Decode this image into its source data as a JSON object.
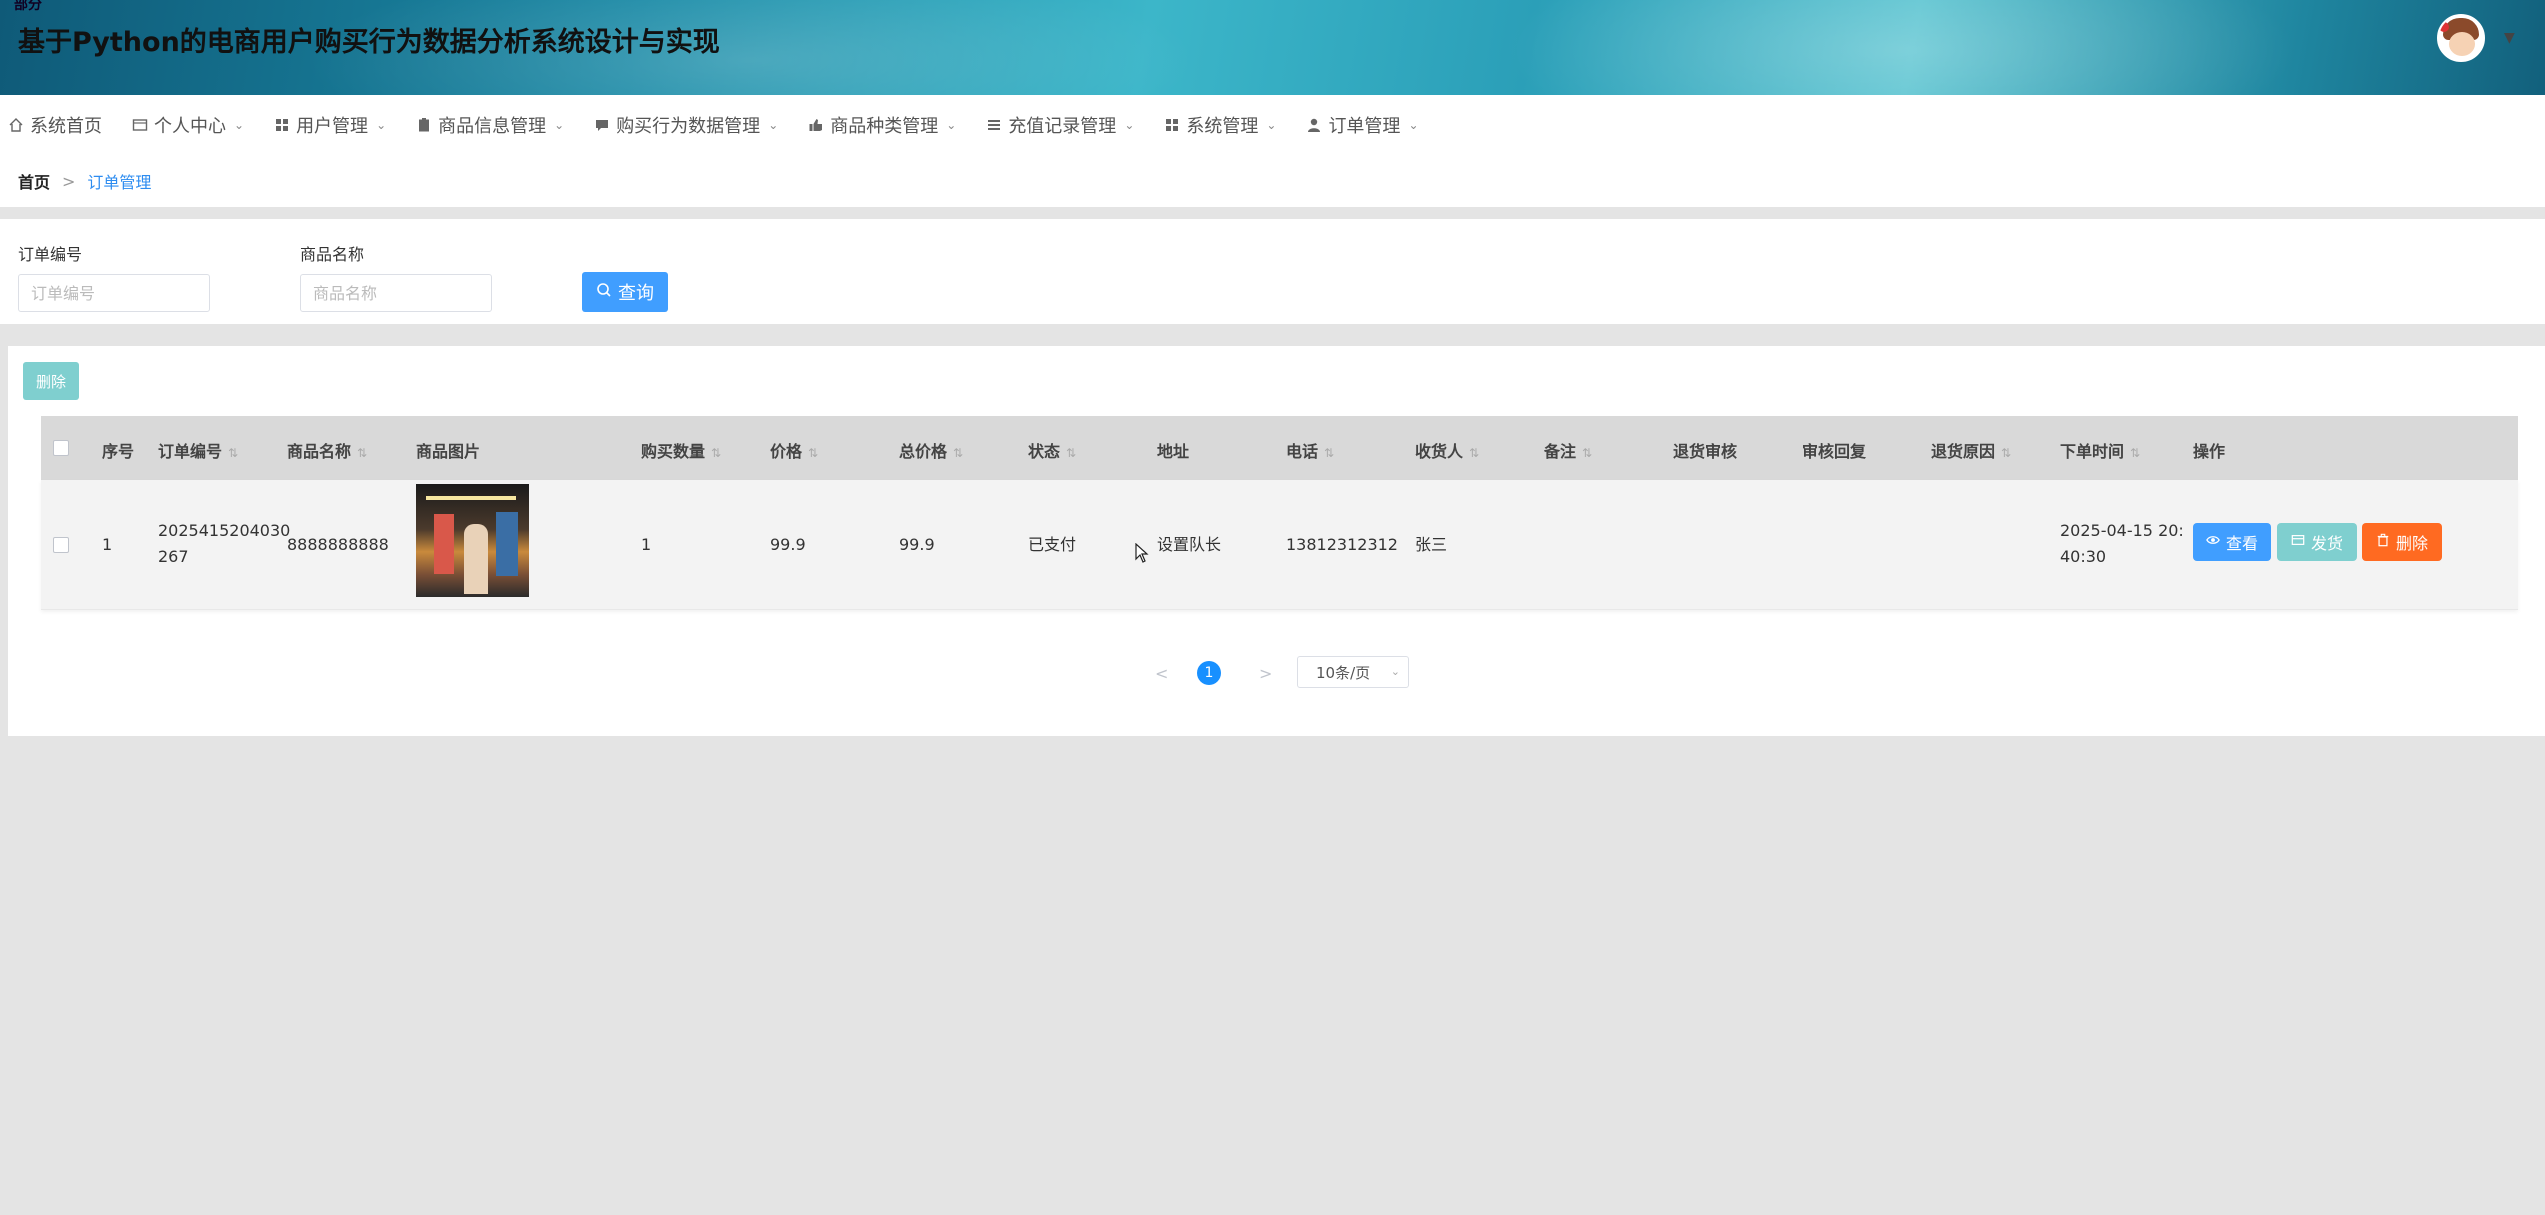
{
  "header": {
    "top_fragment": "部分",
    "title": "基于Python的电商用户购买行为数据分析系统设计与实现",
    "avatar_caret": "▼"
  },
  "nav": {
    "items": [
      {
        "label": "系统首页",
        "icon": "home-icon",
        "has_caret": false
      },
      {
        "label": "个人中心",
        "icon": "id-card-icon",
        "has_caret": true
      },
      {
        "label": "用户管理",
        "icon": "grid-icon",
        "has_caret": true
      },
      {
        "label": "商品信息管理",
        "icon": "clipboard-icon",
        "has_caret": true
      },
      {
        "label": "购买行为数据管理",
        "icon": "chat-icon",
        "has_caret": true
      },
      {
        "label": "商品种类管理",
        "icon": "thumbs-up-icon",
        "has_caret": true
      },
      {
        "label": "充值记录管理",
        "icon": "list-icon",
        "has_caret": true
      },
      {
        "label": "系统管理",
        "icon": "grid-icon",
        "has_caret": true
      },
      {
        "label": "订单管理",
        "icon": "user-icon",
        "has_caret": true
      }
    ]
  },
  "breadcrumb": {
    "home": "首页",
    "separator": ">",
    "current": "订单管理"
  },
  "search": {
    "order_no_label": "订单编号",
    "order_no_placeholder": "订单编号",
    "product_name_label": "商品名称",
    "product_name_placeholder": "商品名称",
    "query_label": "查询"
  },
  "toolbar": {
    "batch_delete_label": "删除"
  },
  "table": {
    "columns": [
      "序号",
      "订单编号",
      "商品名称",
      "商品图片",
      "购买数量",
      "价格",
      "总价格",
      "状态",
      "地址",
      "电话",
      "收货人",
      "备注",
      "退货审核",
      "审核回复",
      "退货原因",
      "下单时间",
      "操作"
    ],
    "rows": [
      {
        "index": "1",
        "order_no_line1": "2025415204030",
        "order_no_line2": "267",
        "product_name": "8888888888",
        "quantity": "1",
        "price": "99.9",
        "total_price": "99.9",
        "status": "已支付",
        "address": "设置队长",
        "phone": "13812312312",
        "receiver": "张三",
        "remark": "",
        "return_review": "",
        "review_reply": "",
        "return_reason": "",
        "order_time_line1": "2025-04-15 20:",
        "order_time_line2": "40:30",
        "view_label": "查看",
        "ship_label": "发货",
        "delete_label": "删除"
      }
    ]
  },
  "pagination": {
    "prev": "<",
    "current_page": "1",
    "next": ">",
    "page_size": "10条/页"
  },
  "colors": {
    "primary": "#409eff",
    "ship": "#7fcfcf",
    "danger": "#ff6a21",
    "page_active": "#1890ff"
  }
}
